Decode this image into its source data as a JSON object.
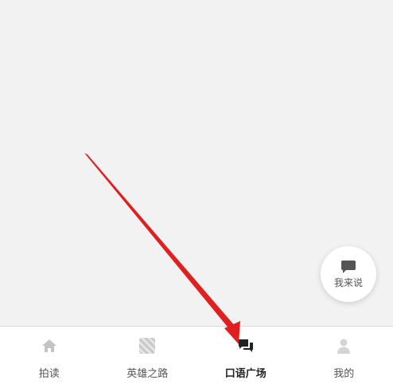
{
  "fab": {
    "label": "我来说",
    "icon": "chat-bubble-icon"
  },
  "tabbar": {
    "tabs": [
      {
        "label": "拍读",
        "icon": "home-icon",
        "active": false
      },
      {
        "label": "英雄之路",
        "icon": "hero-road-icon",
        "active": false
      },
      {
        "label": "口语广场",
        "icon": "chat-bubbles-icon",
        "active": true
      },
      {
        "label": "我的",
        "icon": "person-icon",
        "active": false
      }
    ]
  },
  "colors": {
    "background": "#f3f2f3",
    "tabbar_bg": "#ffffff",
    "inactive_icon": "#c4c4c4",
    "active_icon": "#222222",
    "annotation_arrow": "#e02020"
  }
}
